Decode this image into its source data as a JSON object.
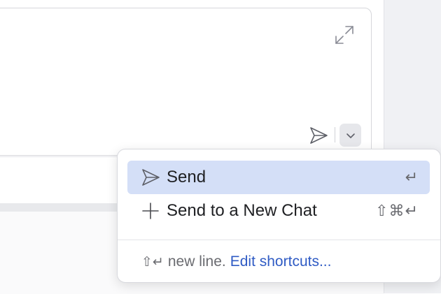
{
  "composer": {
    "expand_icon": "expand-icon",
    "send_icon": "send-icon",
    "dropdown_icon": "chevron-down-icon"
  },
  "send_menu": {
    "items": [
      {
        "label": "Send",
        "icon": "send-icon",
        "shortcut": "↵",
        "selected": true
      },
      {
        "label": "Send to a New Chat",
        "icon": "plus-icon",
        "shortcut": "⇧⌘↵",
        "selected": false
      }
    ],
    "footer": {
      "keys": "⇧↵",
      "hint": "new line.",
      "link": "Edit shortcuts..."
    }
  },
  "colors": {
    "selected_bg": "#d4dff7",
    "link": "#2f5bc4"
  }
}
